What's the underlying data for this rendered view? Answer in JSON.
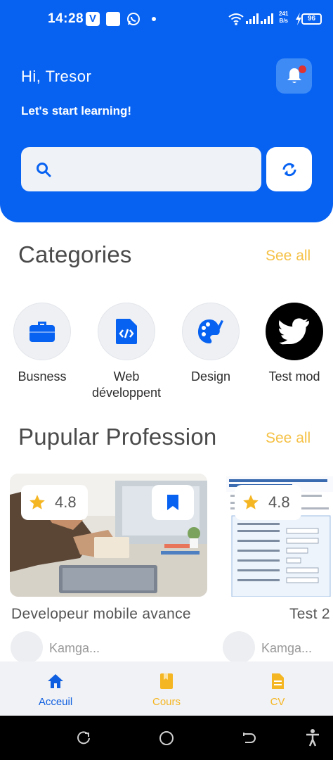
{
  "status_bar": {
    "time": "14:28",
    "app_badge": "V",
    "net_speed_value": "241",
    "net_speed_unit": "B/s",
    "battery": "96"
  },
  "header": {
    "greeting": "Hi,  Tresor",
    "subtitle": "Let's start learning!",
    "search_placeholder": ""
  },
  "categories": {
    "title": "Categories",
    "see_all": "See all",
    "items": [
      {
        "label": "Busness",
        "icon": "briefcase-icon"
      },
      {
        "label": "Web développent",
        "icon": "code-file-icon"
      },
      {
        "label": "Design",
        "icon": "palette-icon"
      },
      {
        "label": "Test mod",
        "icon": "twitter-icon"
      }
    ]
  },
  "popular": {
    "title": "Pupular Profession",
    "see_all": "See all",
    "courses": [
      {
        "title": "Developeur mobile avance",
        "rating": "4.8",
        "author": "Kamga...",
        "image": "designer-desk-photo"
      },
      {
        "title": "Test 2",
        "rating": "4.8",
        "author": "Kamga...",
        "image": "form-document-screenshot"
      }
    ]
  },
  "bottom_nav": {
    "items": [
      {
        "label": "Acceuil",
        "icon": "home-icon",
        "color": "#0f5fe0"
      },
      {
        "label": "Cours",
        "icon": "book-icon",
        "color": "#f5b623"
      },
      {
        "label": "CV",
        "icon": "document-icon",
        "color": "#f5b623"
      }
    ]
  },
  "colors": {
    "primary": "#0762f2",
    "accent": "#f5c146",
    "notification_dot": "#e0322f"
  }
}
